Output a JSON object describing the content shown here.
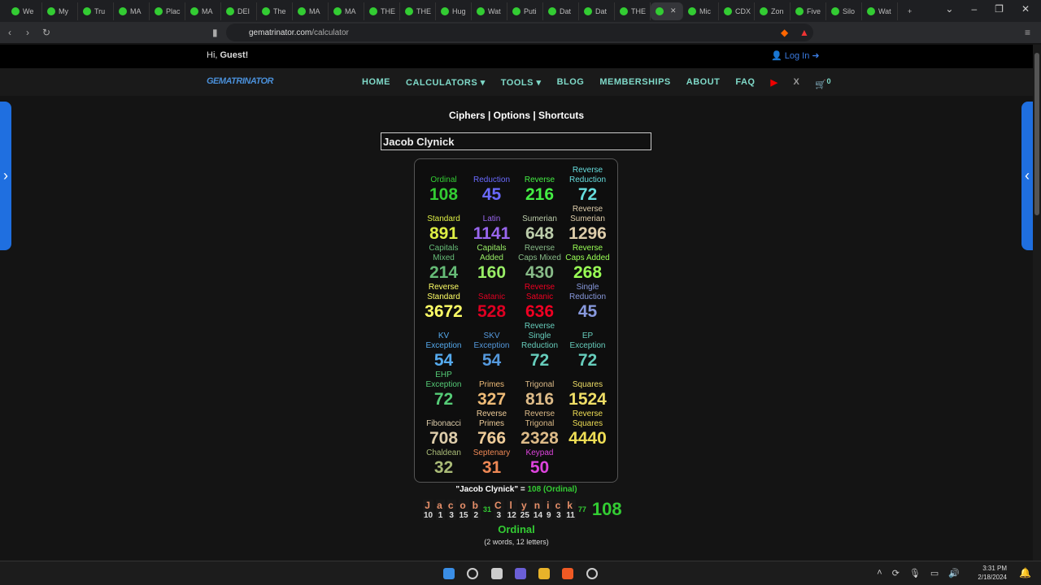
{
  "browser": {
    "tabs": [
      "We",
      "My",
      "Tru",
      "MA",
      "Plac",
      "MA",
      "DEI",
      "The",
      "MA",
      "MA",
      "THE",
      "THE",
      "Hug",
      "Wat",
      "Puti",
      "Dat",
      "Dat",
      "THE",
      "",
      "Mic",
      "CDX",
      "Zon",
      "Five",
      "Silo",
      "Wat"
    ],
    "active_tab": 18,
    "url_domain": "gematrinator.com",
    "url_path": "/calculator"
  },
  "greeting": {
    "hi": "Hi, ",
    "name": "Guest!",
    "login": "Log In"
  },
  "nav": {
    "logo": "GEMATRINATOR",
    "items": [
      "HOME",
      "CALCULATORS ▾",
      "TOOLS ▾",
      "BLOG",
      "MEMBERSHIPS",
      "ABOUT",
      "FAQ"
    ],
    "cart_count": "0"
  },
  "links": "Ciphers | Options | Shortcuts",
  "input": {
    "value": "Jacob Clynick"
  },
  "ciphers": [
    {
      "name": "Ordinal",
      "value": "108",
      "color": "#33cc33"
    },
    {
      "name": "Reduction",
      "value": "45",
      "color": "#6a6aff"
    },
    {
      "name": "Reverse",
      "value": "216",
      "color": "#44ee44"
    },
    {
      "name": "Reverse Reduction",
      "value": "72",
      "color": "#66dddd"
    },
    {
      "name": "Standard",
      "value": "891",
      "color": "#ddee44"
    },
    {
      "name": "Latin",
      "value": "1141",
      "color": "#9966ee"
    },
    {
      "name": "Sumerian",
      "value": "648",
      "color": "#bbccaa"
    },
    {
      "name": "Reverse Sumerian",
      "value": "1296",
      "color": "#ddccaa"
    },
    {
      "name": "Capitals Mixed",
      "value": "214",
      "color": "#66bb77"
    },
    {
      "name": "Capitals Added",
      "value": "160",
      "color": "#99ee66"
    },
    {
      "name": "Reverse Caps Mixed",
      "value": "430",
      "color": "#88bb88"
    },
    {
      "name": "Reverse Caps Added",
      "value": "268",
      "color": "#99ff55"
    },
    {
      "name": "Reverse Standard",
      "value": "3672",
      "color": "#ffff66"
    },
    {
      "name": "Satanic",
      "value": "528",
      "color": "#dd0022"
    },
    {
      "name": "Reverse Satanic",
      "value": "636",
      "color": "#ee0022"
    },
    {
      "name": "Single Reduction",
      "value": "45",
      "color": "#8899dd"
    },
    {
      "name": "KV Exception",
      "value": "54",
      "color": "#55aaee"
    },
    {
      "name": "SKV Exception",
      "value": "54",
      "color": "#5599dd"
    },
    {
      "name": "Reverse Single Reduction",
      "value": "72",
      "color": "#66ccbb"
    },
    {
      "name": "EP Exception",
      "value": "72",
      "color": "#66ccbb"
    },
    {
      "name": "EHP Exception",
      "value": "72",
      "color": "#55cc77"
    },
    {
      "name": "Primes",
      "value": "327",
      "color": "#eebb77"
    },
    {
      "name": "Trigonal",
      "value": "816",
      "color": "#ddbb88"
    },
    {
      "name": "Squares",
      "value": "1524",
      "color": "#eedd66"
    },
    {
      "name": "Fibonacci",
      "value": "708",
      "color": "#ddccaa"
    },
    {
      "name": "Reverse Primes",
      "value": "766",
      "color": "#eecc99"
    },
    {
      "name": "Reverse Trigonal",
      "value": "2328",
      "color": "#ddbb88"
    },
    {
      "name": "Reverse Squares",
      "value": "4440",
      "color": "#eedd55"
    },
    {
      "name": "Chaldean",
      "value": "32",
      "color": "#aabb77"
    },
    {
      "name": "Septenary",
      "value": "31",
      "color": "#ee8855"
    },
    {
      "name": "Keypad",
      "value": "50",
      "color": "#dd44dd"
    }
  ],
  "summary": {
    "phrase": "\"Jacob Clynick\" = ",
    "result": "108 (Ordinal)"
  },
  "breakdown": {
    "words": [
      {
        "letters": [
          "J",
          "a",
          "c",
          "o",
          "b"
        ],
        "values": [
          "10",
          "1",
          "3",
          "15",
          "2"
        ],
        "sum": "31"
      },
      {
        "letters": [
          "C",
          "l",
          "y",
          "n",
          "i",
          "c",
          "k"
        ],
        "values": [
          "3",
          "12",
          "25",
          "14",
          "9",
          "3",
          "11"
        ],
        "sum": "77"
      }
    ],
    "total": "108",
    "cipher": "Ordinal",
    "count": "(2 words, 12 letters)"
  },
  "taskbar": {
    "time": "3:31 PM",
    "date": "2/18/2024"
  }
}
